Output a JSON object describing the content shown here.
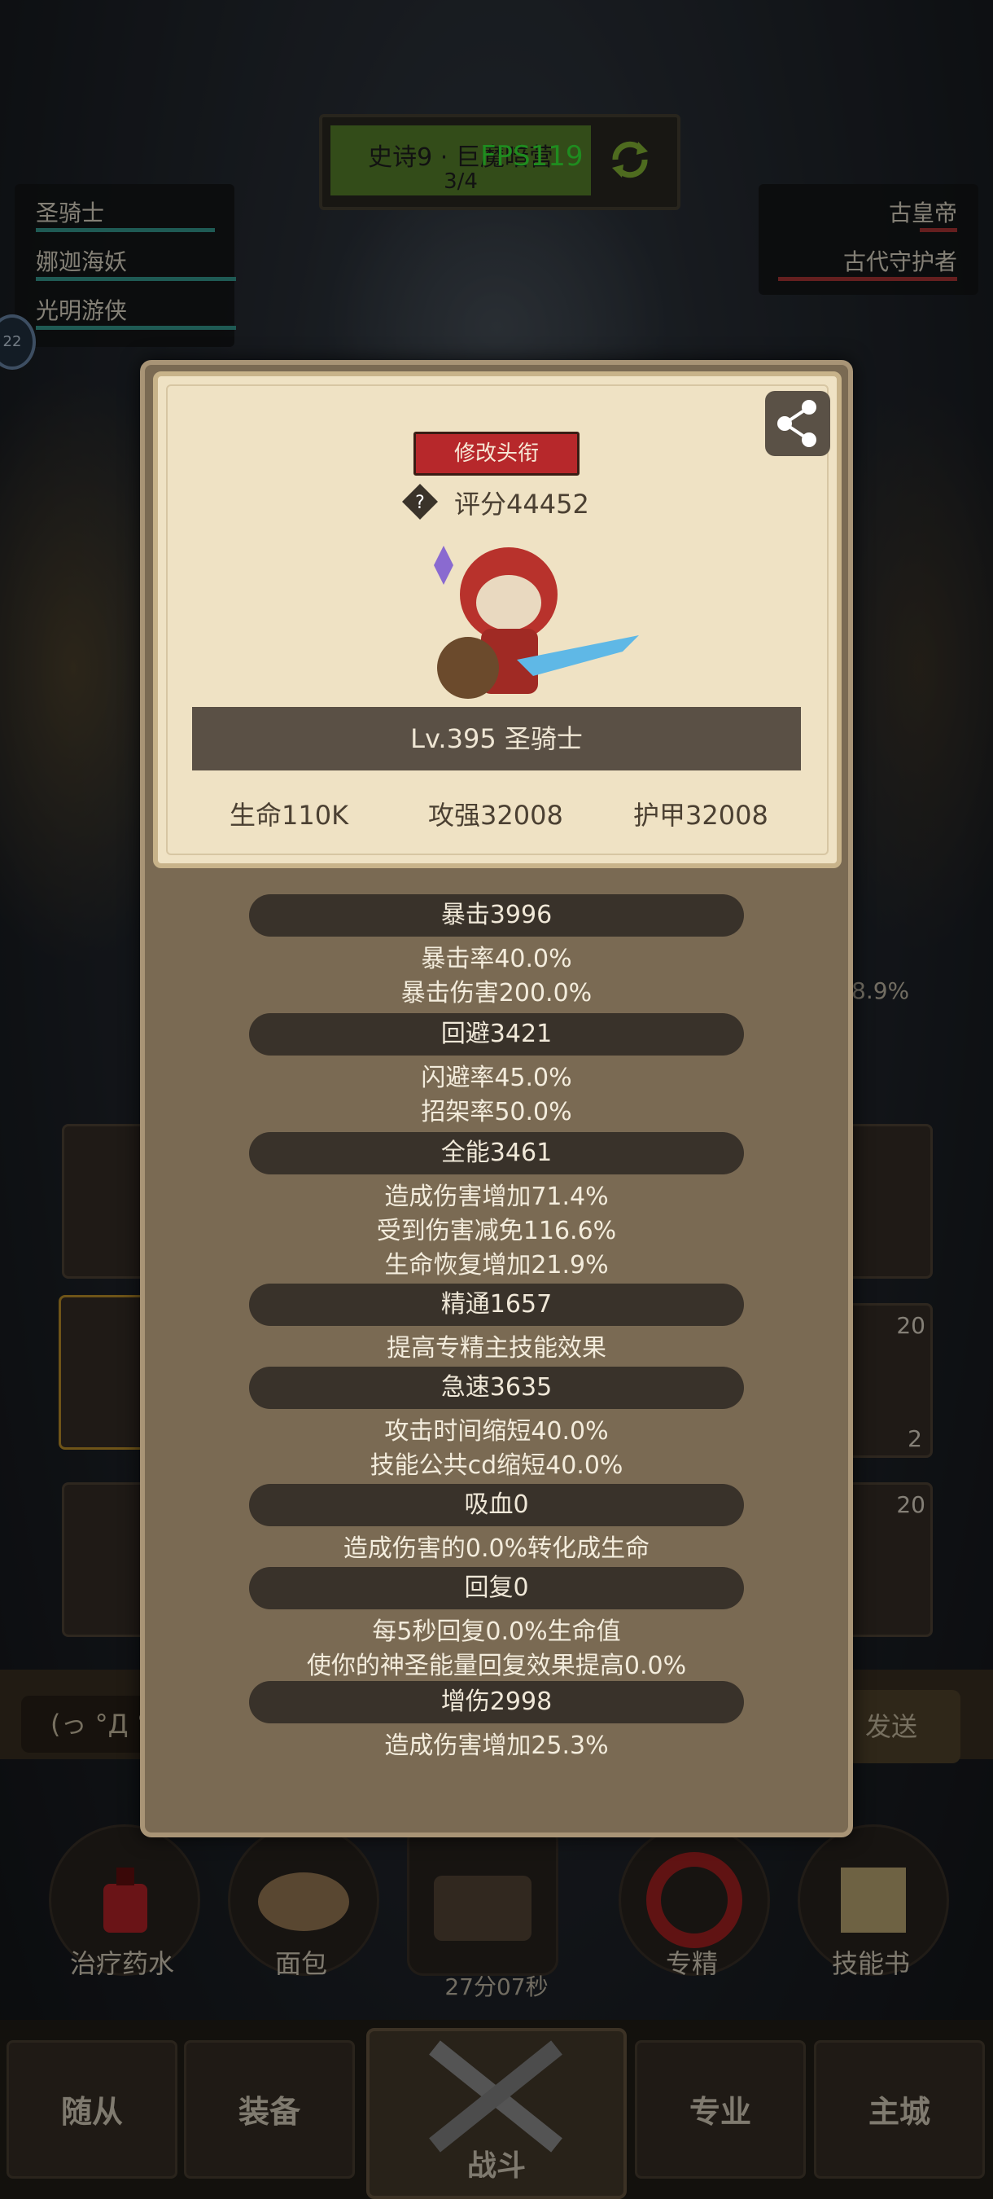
{
  "stage": {
    "title": "史诗9 · 巨魔暗营",
    "progress": "3/4",
    "fps": "FPS119"
  },
  "team_left": [
    {
      "name": "圣骑士",
      "bar_color": "#3aa59a"
    },
    {
      "name": "娜迦海妖",
      "bar_color": "#3aa59a"
    },
    {
      "name": "光明游侠",
      "bar_color": "#3aa59a"
    }
  ],
  "team_right": [
    {
      "name": "古皇帝",
      "bar_color": "#b83a3a"
    },
    {
      "name": "古代守护者",
      "bar_color": "#b83a3a"
    }
  ],
  "level_badge": "22",
  "side_percent": "8.9%",
  "slot_counts": [
    "20",
    "2",
    "20"
  ],
  "card": {
    "title_button": "修改头衔",
    "score": "评分44452",
    "name": "Lv.395 圣骑士",
    "stats": [
      "生命110K",
      "攻强32008",
      "护甲32008"
    ]
  },
  "sections": [
    {
      "head": "暴击3996",
      "lines": [
        "暴击率40.0%",
        "暴击伤害200.0%"
      ]
    },
    {
      "head": "回避3421",
      "lines": [
        "闪避率45.0%",
        "招架率50.0%"
      ]
    },
    {
      "head": "全能3461",
      "lines": [
        "造成伤害增加71.4%",
        "受到伤害减免116.6%",
        "生命恢复增加21.9%"
      ]
    },
    {
      "head": "精通1657",
      "lines": [
        "提高专精主技能效果"
      ]
    },
    {
      "head": "急速3635",
      "lines": [
        "攻击时间缩短40.0%",
        "技能公共cd缩短40.0%"
      ]
    },
    {
      "head": "吸血0",
      "lines": [
        "造成伤害的0.0%转化成生命"
      ]
    },
    {
      "head": "回复0",
      "lines": [
        "每5秒回复0.0%生命值",
        "使你的神圣能量回复效果提高0.0%"
      ]
    },
    {
      "head": "增伤2998",
      "lines": [
        "造成伤害增加25.3%"
      ]
    }
  ],
  "chat": {
    "input": "(っ °Д °;)っ",
    "send": "发送"
  },
  "items": [
    "治疗药水",
    "面包",
    "专精",
    "技能书"
  ],
  "timer": "27分07秒",
  "nav": {
    "followers": "随从",
    "equipment": "装备",
    "battle": "战斗",
    "profession": "专业",
    "city": "主城"
  },
  "colors": {
    "accent_red": "#b7282b",
    "panel": "#7a6a53",
    "card": "#efe2c4",
    "fps": "#39ff3a"
  }
}
